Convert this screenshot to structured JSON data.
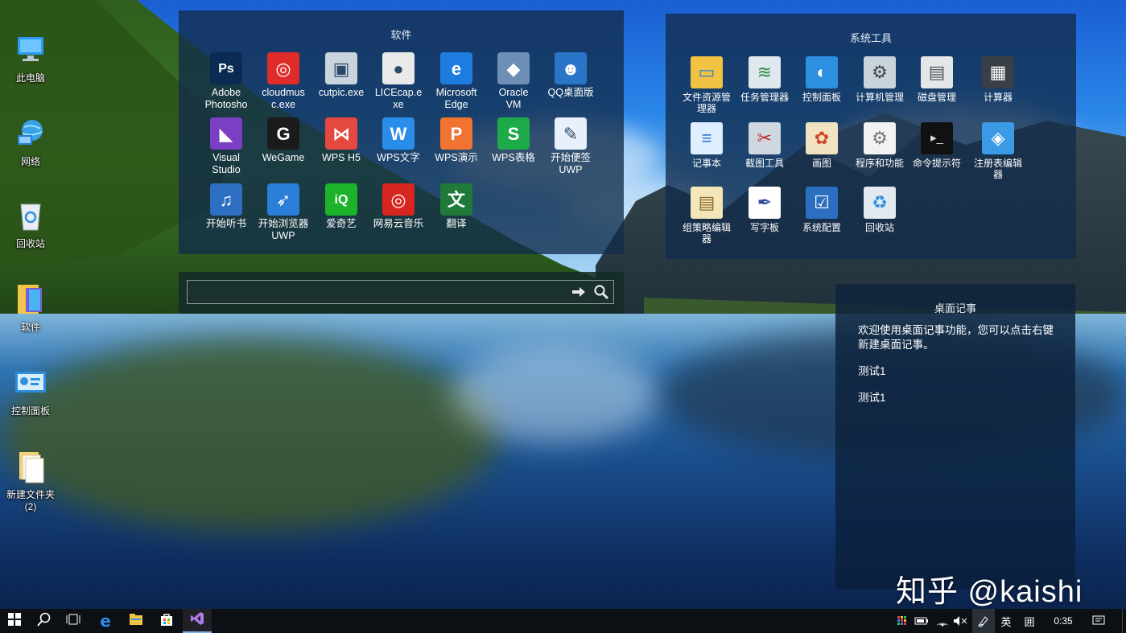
{
  "desktop_icons": [
    {
      "label": "此电脑",
      "icon": "computer-icon"
    },
    {
      "label": "网络",
      "icon": "network-icon"
    },
    {
      "label": "回收站",
      "icon": "recycle-bin-icon"
    },
    {
      "label": "软件",
      "icon": "folder-icon"
    },
    {
      "label": "控制面板",
      "icon": "control-panel-icon"
    },
    {
      "label": "新建文件夹\n(2)",
      "icon": "folder-icon"
    }
  ],
  "software_panel": {
    "title": "软件",
    "apps": [
      {
        "label": "Adobe\nPhotosho",
        "icon": "photoshop-icon",
        "color": "#0b2b52"
      },
      {
        "label": "cloudmus\nc.exe",
        "icon": "netease-music-icon",
        "color": "#e02b2b"
      },
      {
        "label": "cutpic.exe",
        "icon": "cutpic-icon",
        "color": "#c9d4de"
      },
      {
        "label": "LICEcap.e\nxe",
        "icon": "licecap-icon",
        "color": "#e9e9e9"
      },
      {
        "label": "Microsoft\nEdge",
        "icon": "edge-icon",
        "color": "#1e7be0"
      },
      {
        "label": "Oracle\nVM",
        "icon": "virtualbox-icon",
        "color": "#6d8fb6"
      },
      {
        "label": "QQ桌面版",
        "icon": "qq-icon",
        "color": "#2b75c8"
      },
      {
        "label": "Visual\nStudio",
        "icon": "visual-studio-icon",
        "color": "#7b3fc4"
      },
      {
        "label": "WeGame",
        "icon": "wegame-icon",
        "color": "#1b1b1b"
      },
      {
        "label": "WPS H5",
        "icon": "wps-h5-icon",
        "color": "#e5483f"
      },
      {
        "label": "WPS文字",
        "icon": "wps-writer-icon",
        "color": "#2a8ee8"
      },
      {
        "label": "WPS演示",
        "icon": "wps-presentation-icon",
        "color": "#f07331"
      },
      {
        "label": "WPS表格",
        "icon": "wps-spreadsheet-icon",
        "color": "#1daa48"
      },
      {
        "label": "开始便签\nUWP",
        "icon": "sticky-note-icon",
        "color": "#e8f1fb"
      },
      {
        "label": "开始听书",
        "icon": "audiobook-icon",
        "color": "#2d6fc2"
      },
      {
        "label": "开始浏览器\nUWP",
        "icon": "rocket-browser-icon",
        "color": "#2b7fd8"
      },
      {
        "label": "爱奇艺",
        "icon": "iqiyi-icon",
        "color": "#1cb32a"
      },
      {
        "label": "网易云音乐",
        "icon": "cloud-music-icon",
        "color": "#d9251f"
      },
      {
        "label": "翻译",
        "icon": "translate-icon",
        "color": "#1f7a3a"
      }
    ]
  },
  "search": {
    "placeholder": "",
    "go_icon": "arrow-right-icon",
    "search_icon": "search-icon"
  },
  "tools_panel": {
    "title": "系统工具",
    "tools": [
      {
        "label": "文件资源管\n理器",
        "icon": "file-explorer-icon"
      },
      {
        "label": "任务管理器",
        "icon": "task-manager-icon"
      },
      {
        "label": "控制面板",
        "icon": "control-panel-icon"
      },
      {
        "label": "计算机管理",
        "icon": "computer-management-icon"
      },
      {
        "label": "磁盘管理",
        "icon": "disk-management-icon"
      },
      {
        "label": "计算器",
        "icon": "calculator-icon"
      },
      {
        "label": "记事本",
        "icon": "notepad-icon"
      },
      {
        "label": "截图工具",
        "icon": "snipping-tool-icon"
      },
      {
        "label": "画图",
        "icon": "paint-icon"
      },
      {
        "label": "程序和功能",
        "icon": "programs-features-icon"
      },
      {
        "label": "命令提示符",
        "icon": "cmd-icon"
      },
      {
        "label": "注册表编辑\n器",
        "icon": "regedit-icon"
      },
      {
        "label": "组策略编辑\n器",
        "icon": "group-policy-icon"
      },
      {
        "label": "写字板",
        "icon": "wordpad-icon"
      },
      {
        "label": "系统配置",
        "icon": "system-config-icon"
      },
      {
        "label": "回收站",
        "icon": "recycle-bin-icon"
      }
    ]
  },
  "notes_panel": {
    "title": "桌面记事",
    "lines": [
      "欢迎使用桌面记事功能，您可以点击右键新建桌面记事。",
      "测试1",
      "测试1"
    ]
  },
  "taskbar": {
    "buttons": [
      "windows-start-icon",
      "search-icon",
      "task-view-icon",
      "edge-icon",
      "file-explorer-icon",
      "store-icon",
      "visual-studio-icon"
    ],
    "tray": {
      "ime_lang": "英",
      "ime_mode": "囲",
      "time": "0:35"
    }
  },
  "watermark": "知乎 @kaishi"
}
